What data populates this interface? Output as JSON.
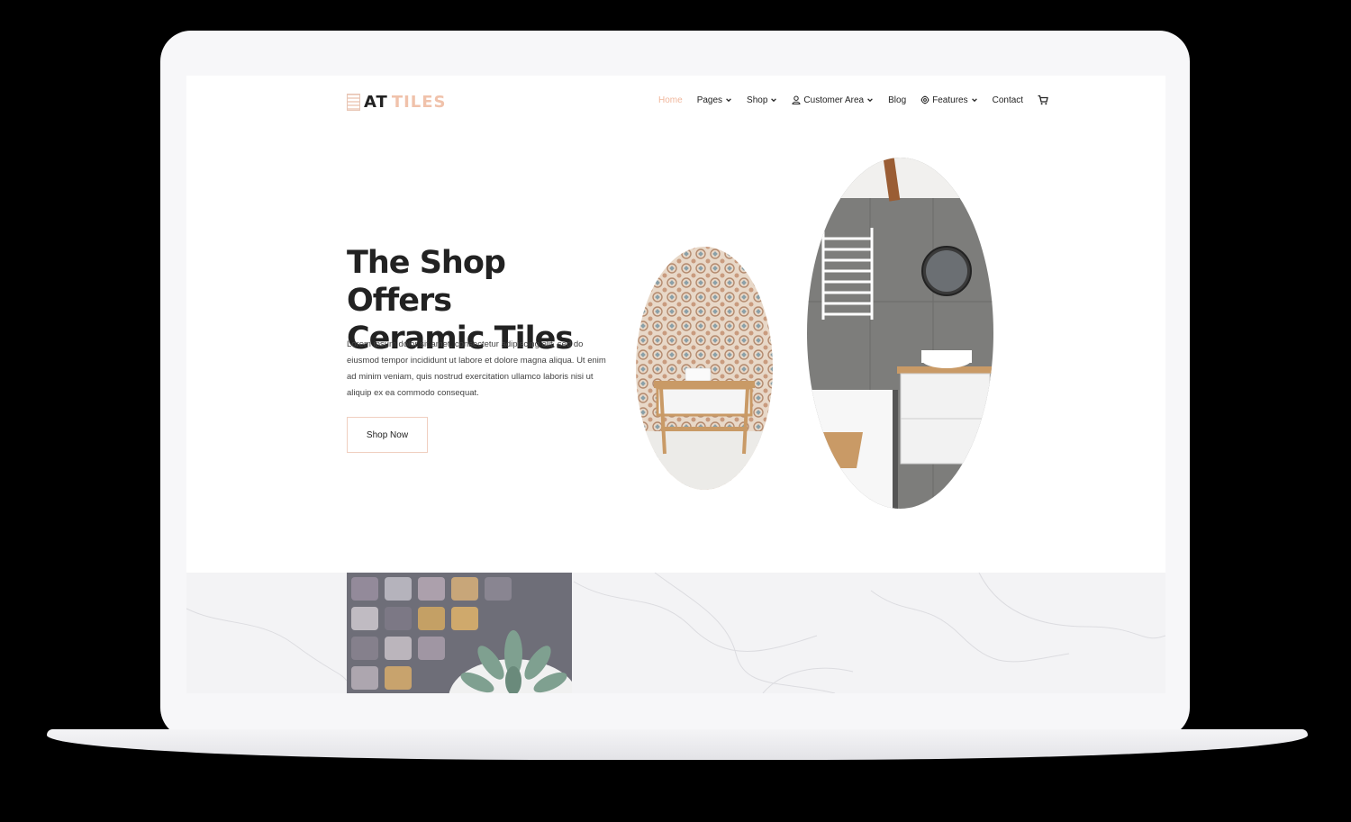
{
  "header": {
    "logo": {
      "word1": "AT",
      "word2": "TILES"
    },
    "nav": [
      {
        "label": "Home",
        "active": true
      },
      {
        "label": "Pages",
        "dropdown": true
      },
      {
        "label": "Shop",
        "dropdown": true
      },
      {
        "label": "Customer Area",
        "dropdown": true,
        "icon": "user-icon"
      },
      {
        "label": "Blog"
      },
      {
        "label": "Features",
        "dropdown": true,
        "icon": "gear-icon"
      },
      {
        "label": "Contact"
      }
    ],
    "cart_icon": "cart-icon"
  },
  "hero": {
    "title_line1": "The Shop Offers",
    "title_line2": "Ceramic Tiles",
    "text": "Lorem ipsum dolor sit amet, consectetur adipiscing elit, sed do eiusmod tempor incididunt ut labore et dolore magna aliqua. Ut enim ad minim veniam, quis nostrud exercitation ullamco laboris nisi ut aliquip ex ea commodo consequat.",
    "button_label": "Shop Now"
  },
  "colors": {
    "accent": "#f0b79c",
    "text": "#222222",
    "background": "#ffffff",
    "marble": "#f3f3f5"
  }
}
